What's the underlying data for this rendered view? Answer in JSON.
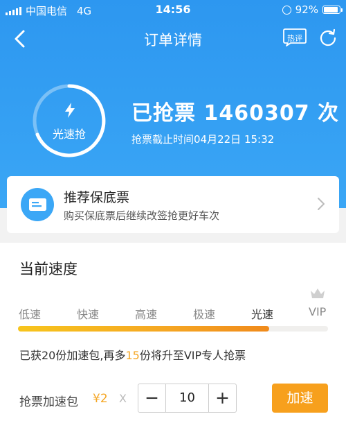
{
  "status_bar": {
    "carrier": "中国电信",
    "network": "4G",
    "time": "14:56",
    "battery": "92%"
  },
  "nav": {
    "title": "订单详情",
    "hot_label": "热评"
  },
  "grab": {
    "ring_label": "光速抢",
    "title": "已抢票 1460307 次",
    "deadline": "抢票截止时间04月22日 15:32"
  },
  "card": {
    "title": "推荐保底票",
    "subtitle": "购买保底票后继续改签抢更好车次"
  },
  "speed": {
    "section_title": "当前速度",
    "levels": [
      "低速",
      "快速",
      "高速",
      "极速",
      "光速",
      "VIP"
    ],
    "active_level": "光速",
    "progress": 0.81,
    "info_prefix": "已获20份加速包,再多",
    "info_highlight": "15",
    "info_suffix": "份将升至VIP专人抢票"
  },
  "package": {
    "label": "抢票加速包",
    "price": "¥2",
    "multiplier": "X",
    "quantity": "10",
    "button": "加速"
  },
  "colors": {
    "brand_blue": "#2d97f0",
    "accent_orange": "#f7a01d",
    "progress_yellow": "#f7c51d"
  }
}
